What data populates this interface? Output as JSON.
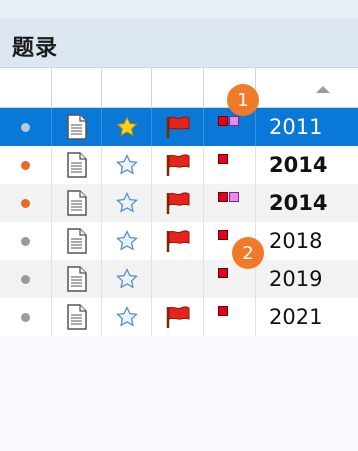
{
  "panel": {
    "title": "题录"
  },
  "header": {
    "sort": "ascending"
  },
  "rows": [
    {
      "status": "gray",
      "starred": true,
      "flagged": true,
      "tags": [
        "red",
        "pink"
      ],
      "year": "2011",
      "bold": false,
      "selected": true
    },
    {
      "status": "orange",
      "starred": false,
      "flagged": true,
      "tags": [
        "red"
      ],
      "year": "2014",
      "bold": true,
      "selected": false
    },
    {
      "status": "orange",
      "starred": false,
      "flagged": true,
      "tags": [
        "red",
        "pink"
      ],
      "year": "2014",
      "bold": true,
      "selected": false
    },
    {
      "status": "gray",
      "starred": false,
      "flagged": true,
      "tags": [
        "red"
      ],
      "year": "2018",
      "bold": false,
      "selected": false
    },
    {
      "status": "gray",
      "starred": false,
      "flagged": false,
      "tags": [
        "red"
      ],
      "year": "2019",
      "bold": false,
      "selected": false
    },
    {
      "status": "gray",
      "starred": false,
      "flagged": true,
      "tags": [
        "red"
      ],
      "year": "2021",
      "bold": false,
      "selected": false
    }
  ],
  "callouts": [
    "1",
    "2"
  ]
}
